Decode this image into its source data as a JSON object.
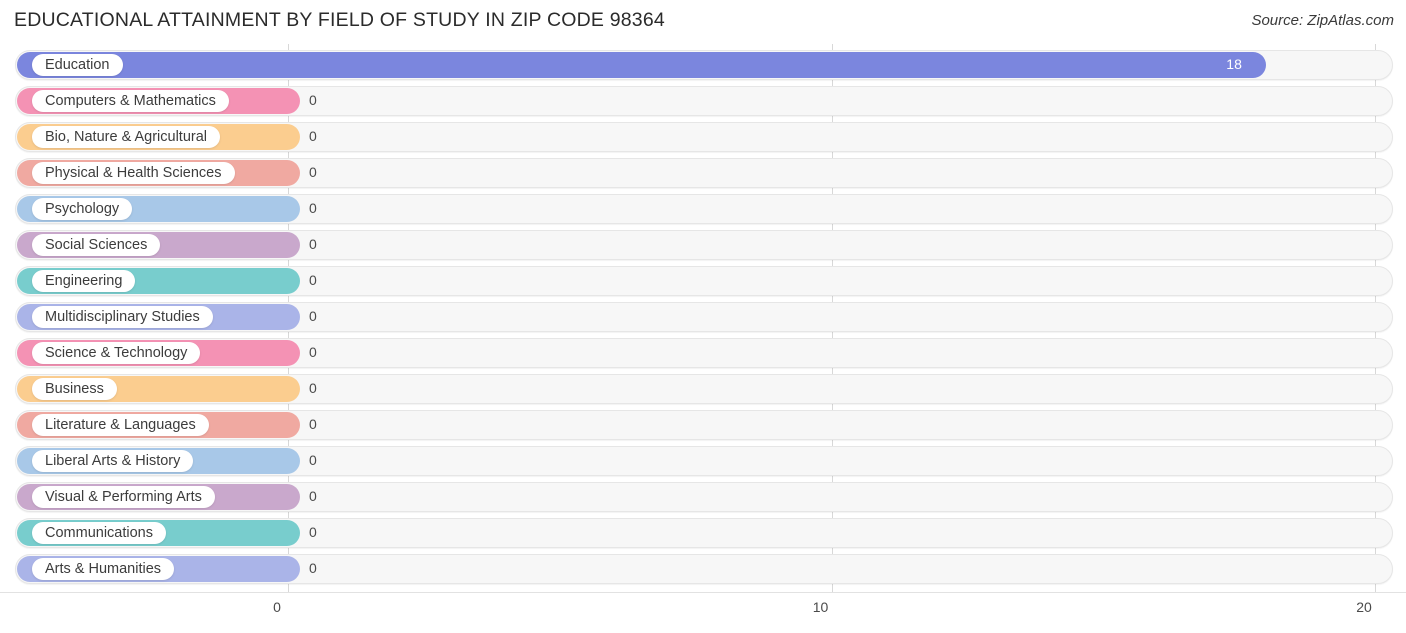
{
  "header": {
    "title": "EDUCATIONAL ATTAINMENT BY FIELD OF STUDY IN ZIP CODE 98364",
    "source": "Source: ZipAtlas.com"
  },
  "chart_data": {
    "type": "bar",
    "orientation": "horizontal",
    "title": "EDUCATIONAL ATTAINMENT BY FIELD OF STUDY IN ZIP CODE 98364",
    "xlabel": "",
    "ylabel": "",
    "xlim": [
      0,
      20
    ],
    "xticks": [
      0,
      10,
      20
    ],
    "xtick_labels": [
      "0",
      "10",
      "20"
    ],
    "grid": true,
    "legend": "none",
    "categories": [
      "Education",
      "Computers & Mathematics",
      "Bio, Nature & Agricultural",
      "Physical & Health Sciences",
      "Psychology",
      "Social Sciences",
      "Engineering",
      "Multidisciplinary Studies",
      "Science & Technology",
      "Business",
      "Literature & Languages",
      "Liberal Arts & History",
      "Visual & Performing Arts",
      "Communications",
      "Arts & Humanities"
    ],
    "values": [
      18,
      0,
      0,
      0,
      0,
      0,
      0,
      0,
      0,
      0,
      0,
      0,
      0,
      0,
      0
    ],
    "value_labels": [
      "18",
      "0",
      "0",
      "0",
      "0",
      "0",
      "0",
      "0",
      "0",
      "0",
      "0",
      "0",
      "0",
      "0",
      "0"
    ],
    "bar_colors": [
      "#7b86de",
      "#f492b4",
      "#fbcd8f",
      "#f0a9a1",
      "#a8c8e8",
      "#c9a8cc",
      "#78cdcd",
      "#aab4e8",
      "#f492b4",
      "#fbcd8f",
      "#f0a9a1",
      "#a8c8e8",
      "#c9a8cc",
      "#78cdcd",
      "#aab4e8"
    ]
  },
  "colors": {
    "track_fill": "#f7f7f7",
    "track_border": "#e6e6e6",
    "gridline": "#d8d8d8",
    "label_pill": "#ffffff",
    "text": "#3c3c3c"
  }
}
